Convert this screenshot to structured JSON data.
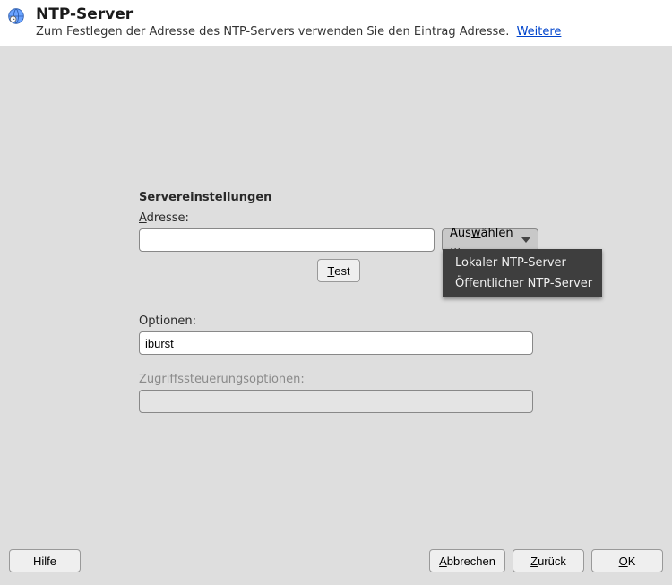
{
  "header": {
    "title": "NTP-Server",
    "subtitle": "Zum Festlegen der Adresse des NTP-Servers verwenden Sie den Eintrag Adresse.",
    "more_link": "Weitere"
  },
  "form": {
    "section_title": "Servereinstellungen",
    "address": {
      "label_pre": "A",
      "label_post": "dresse:",
      "value": "",
      "select_pre": "Aus",
      "select_u": "w",
      "select_post": "ählen ...",
      "menu": {
        "item1": "Lokaler NTP-Server",
        "item2": "Öffentlicher NTP-Server"
      }
    },
    "test": {
      "label_pre": "T",
      "label_post": "est"
    },
    "options": {
      "label": "Optionen:",
      "value": "iburst"
    },
    "access": {
      "label": "Zugriffssteuerungsoptionen:",
      "value": ""
    }
  },
  "footer": {
    "help": "Hilfe",
    "cancel_pre": "A",
    "cancel_post": "bbrechen",
    "back_pre": "Z",
    "back_post": "urück",
    "ok_pre": "O",
    "ok_post": "K"
  }
}
